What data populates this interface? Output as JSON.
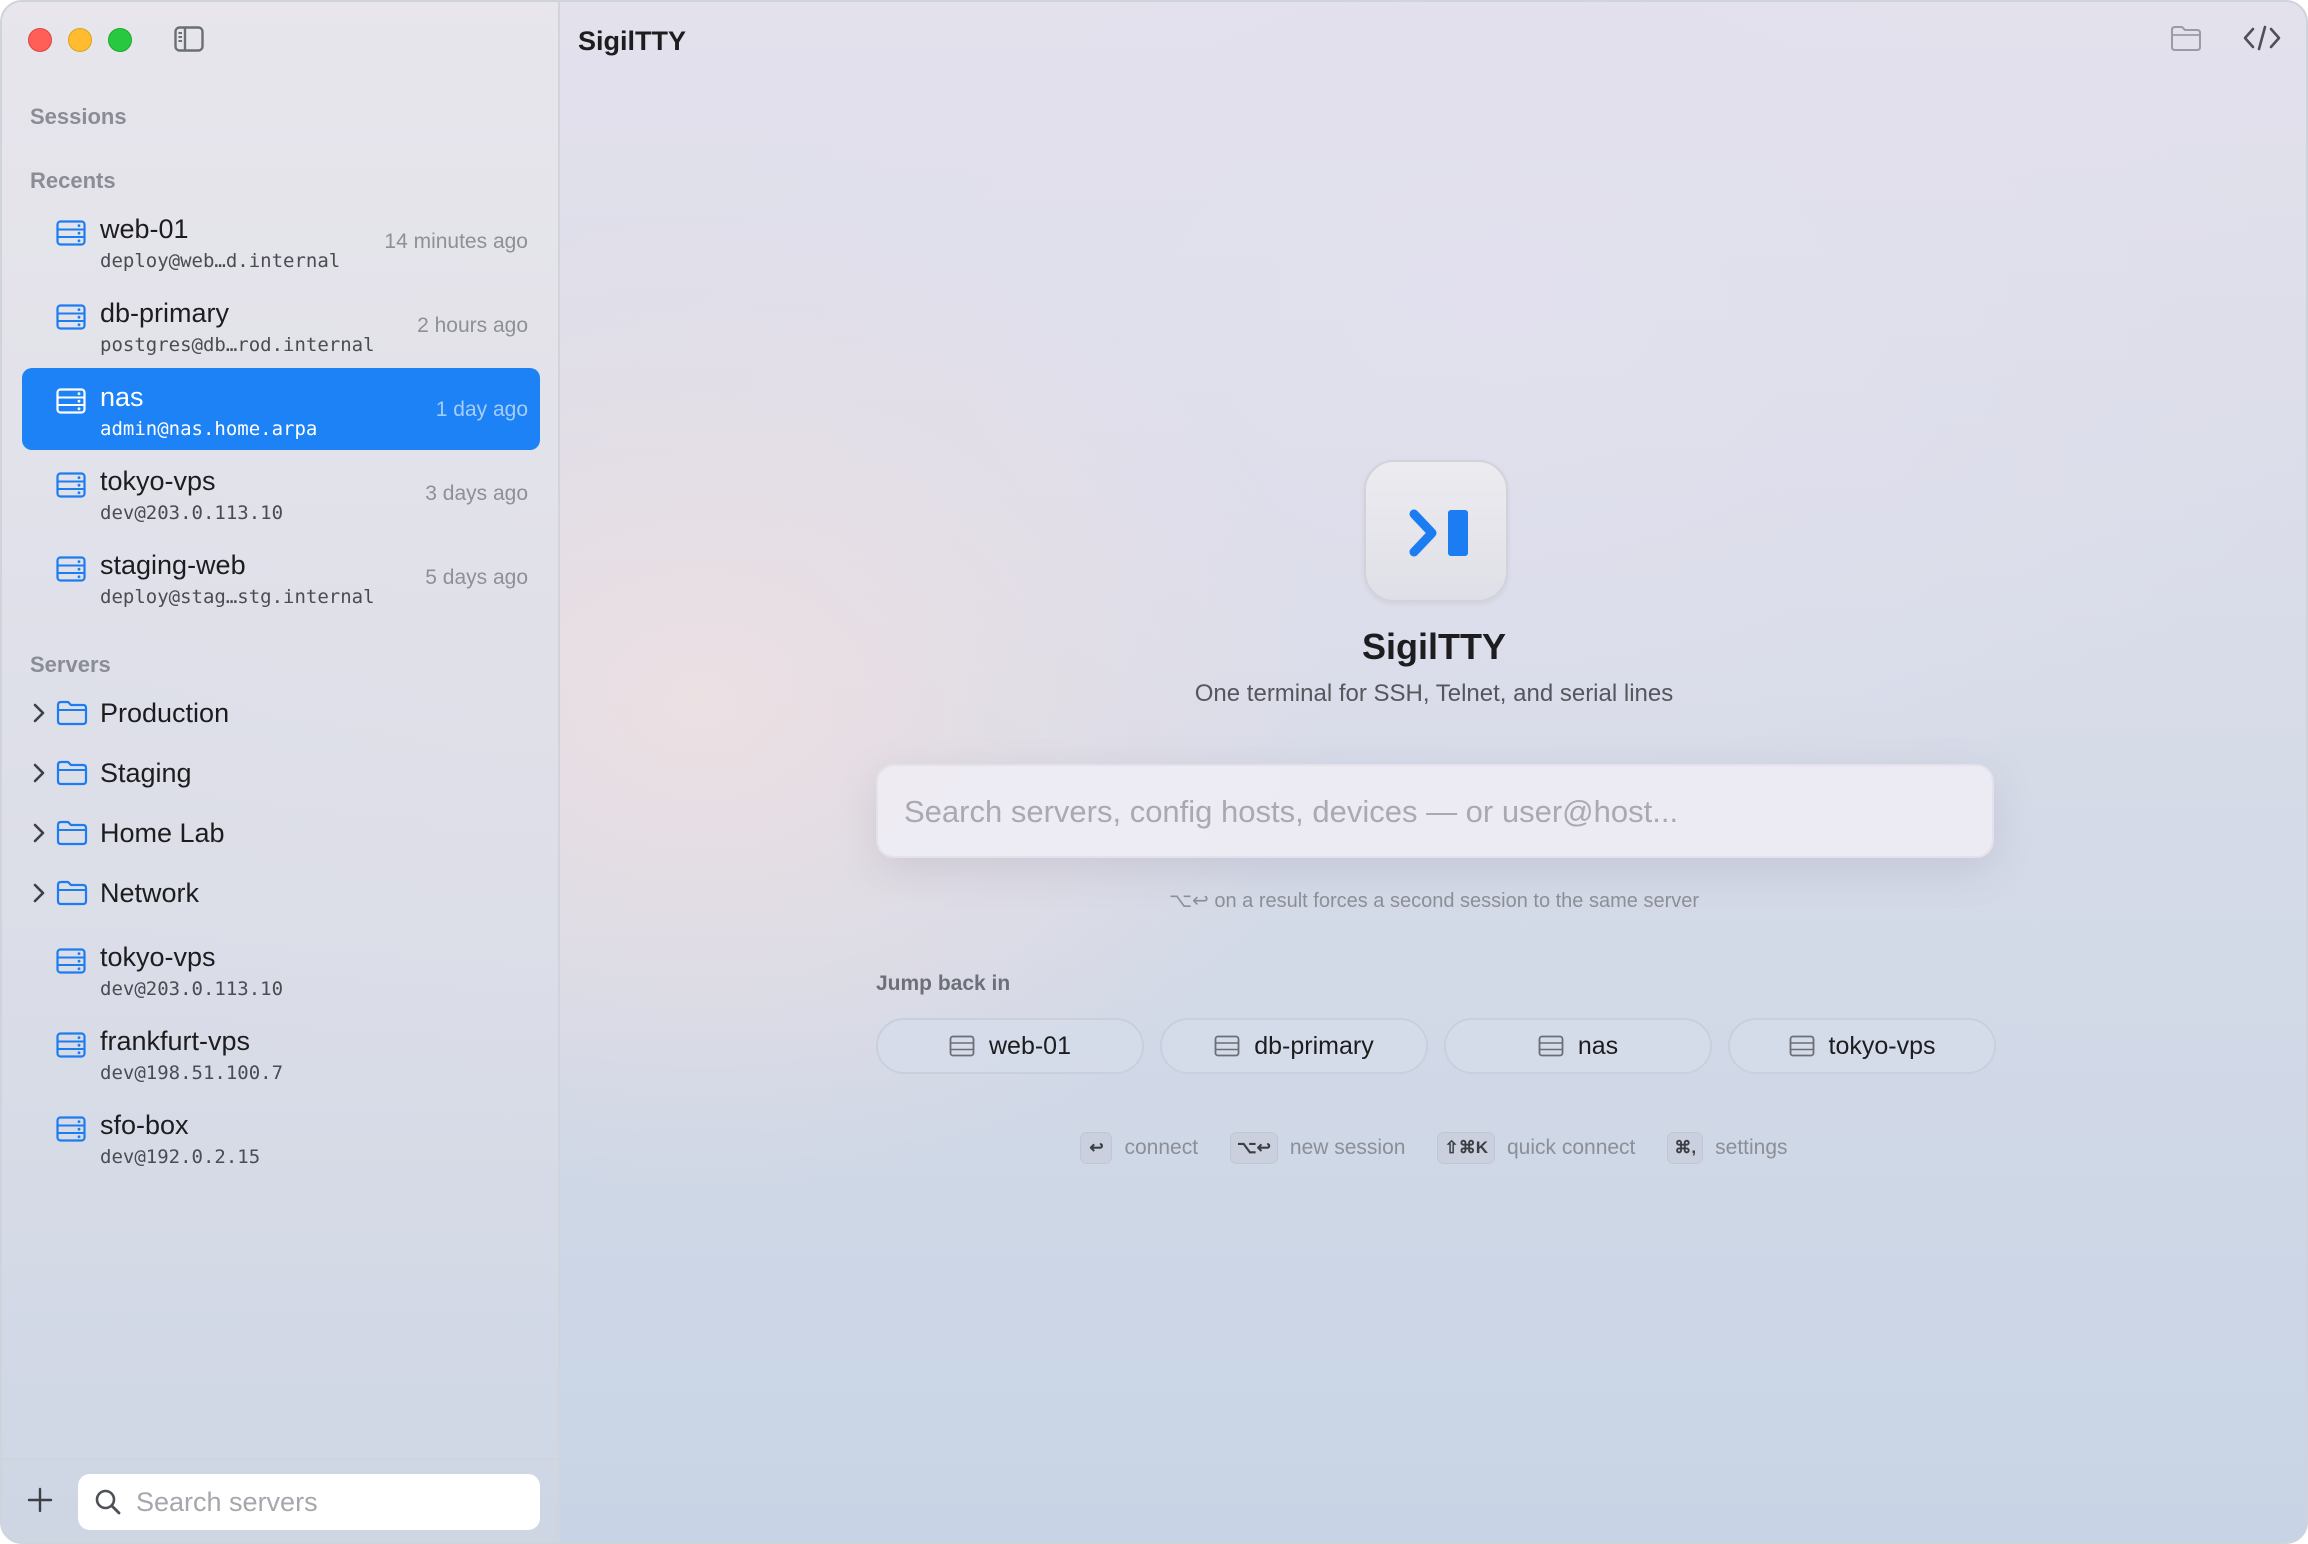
{
  "sidebar": {
    "sessions_label": "Sessions",
    "recents_label": "Recents",
    "servers_label": "Servers",
    "recents": [
      {
        "name": "web-01",
        "sub": "deploy@web…d.internal",
        "time": "14 minutes ago"
      },
      {
        "name": "db-primary",
        "sub": "postgres@db…rod.internal",
        "time": "2 hours ago"
      },
      {
        "name": "nas",
        "sub": "admin@nas.home.arpa",
        "time": "1 day ago",
        "selected": true
      },
      {
        "name": "tokyo-vps",
        "sub": "dev@203.0.113.10",
        "time": "3 days ago"
      },
      {
        "name": "staging-web",
        "sub": "deploy@stag…stg.internal",
        "time": "5 days ago"
      }
    ],
    "folders": [
      {
        "name": "Production"
      },
      {
        "name": "Staging"
      },
      {
        "name": "Home Lab"
      },
      {
        "name": "Network"
      }
    ],
    "servers": [
      {
        "name": "tokyo-vps",
        "sub": "dev@203.0.113.10"
      },
      {
        "name": "frankfurt-vps",
        "sub": "dev@198.51.100.7"
      },
      {
        "name": "sfo-box",
        "sub": "dev@192.0.2.15"
      }
    ],
    "search_placeholder": "Search servers"
  },
  "main": {
    "title": "SigilTTY",
    "app_name": "SigilTTY",
    "tagline": "One terminal for SSH, Telnet, and serial lines",
    "search_placeholder": "Search servers, config hosts, devices — or user@host...",
    "hint": "⌥↩ on a result forces a second session to the same server",
    "jump_label": "Jump back in",
    "jump_items": [
      "web-01",
      "db-primary",
      "nas",
      "tokyo-vps"
    ],
    "shortcuts": [
      {
        "key": "↩",
        "label": "connect"
      },
      {
        "key": "⌥↩",
        "label": "new session"
      },
      {
        "key": "⇧⌘K",
        "label": "quick connect"
      },
      {
        "key": "⌘,",
        "label": "settings"
      }
    ]
  },
  "colors": {
    "accent": "#1c82f5",
    "selected_text": "#ffffff"
  }
}
